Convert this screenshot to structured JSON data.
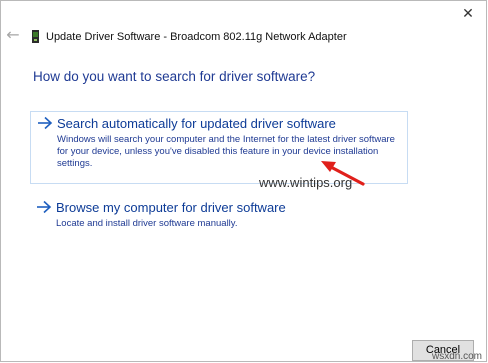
{
  "window": {
    "title": "Update Driver Software - Broadcom 802.11g Network Adapter",
    "close_glyph": "✕",
    "back_glyph": "←",
    "icon": "network-adapter-icon"
  },
  "main": {
    "question": "How do you want to search for driver software?",
    "options": [
      {
        "title": "Search automatically for updated driver software",
        "description": "Windows will search your computer and the Internet for the latest driver software for your device, unless you've disabled this feature in your device installation settings."
      },
      {
        "title": "Browse my computer for driver software",
        "description": "Locate and install driver software manually."
      }
    ]
  },
  "watermark": "www.wintips.org",
  "footer": {
    "cancel_label": "Cancel",
    "credit": "wsxdn.com"
  },
  "colors": {
    "accent": "#1f3a93",
    "annotation_arrow": "#e0201b"
  }
}
